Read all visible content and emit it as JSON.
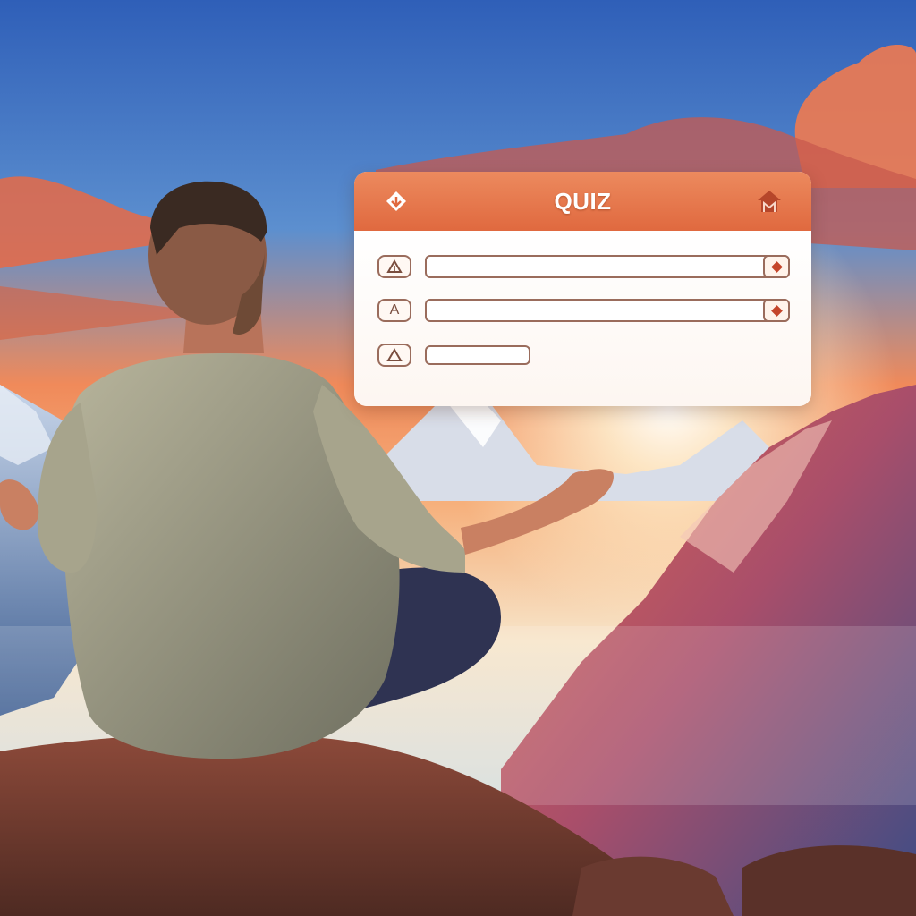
{
  "quiz": {
    "title": "QUIZ",
    "header_left_icon": "down-arrow-icon",
    "header_right_icon": "home-icon",
    "options": [
      {
        "icon_label": "",
        "icon": "triangle-icon",
        "value": "",
        "has_dropdown": true
      },
      {
        "icon_label": "A",
        "icon": "letter-a-icon",
        "value": "",
        "has_dropdown": true
      },
      {
        "icon_label": "",
        "icon": "triangle-icon",
        "value": "",
        "has_dropdown": false
      }
    ]
  },
  "colors": {
    "header": "#e0693f",
    "border": "#9a6c5c",
    "accent": "#c4452a"
  }
}
